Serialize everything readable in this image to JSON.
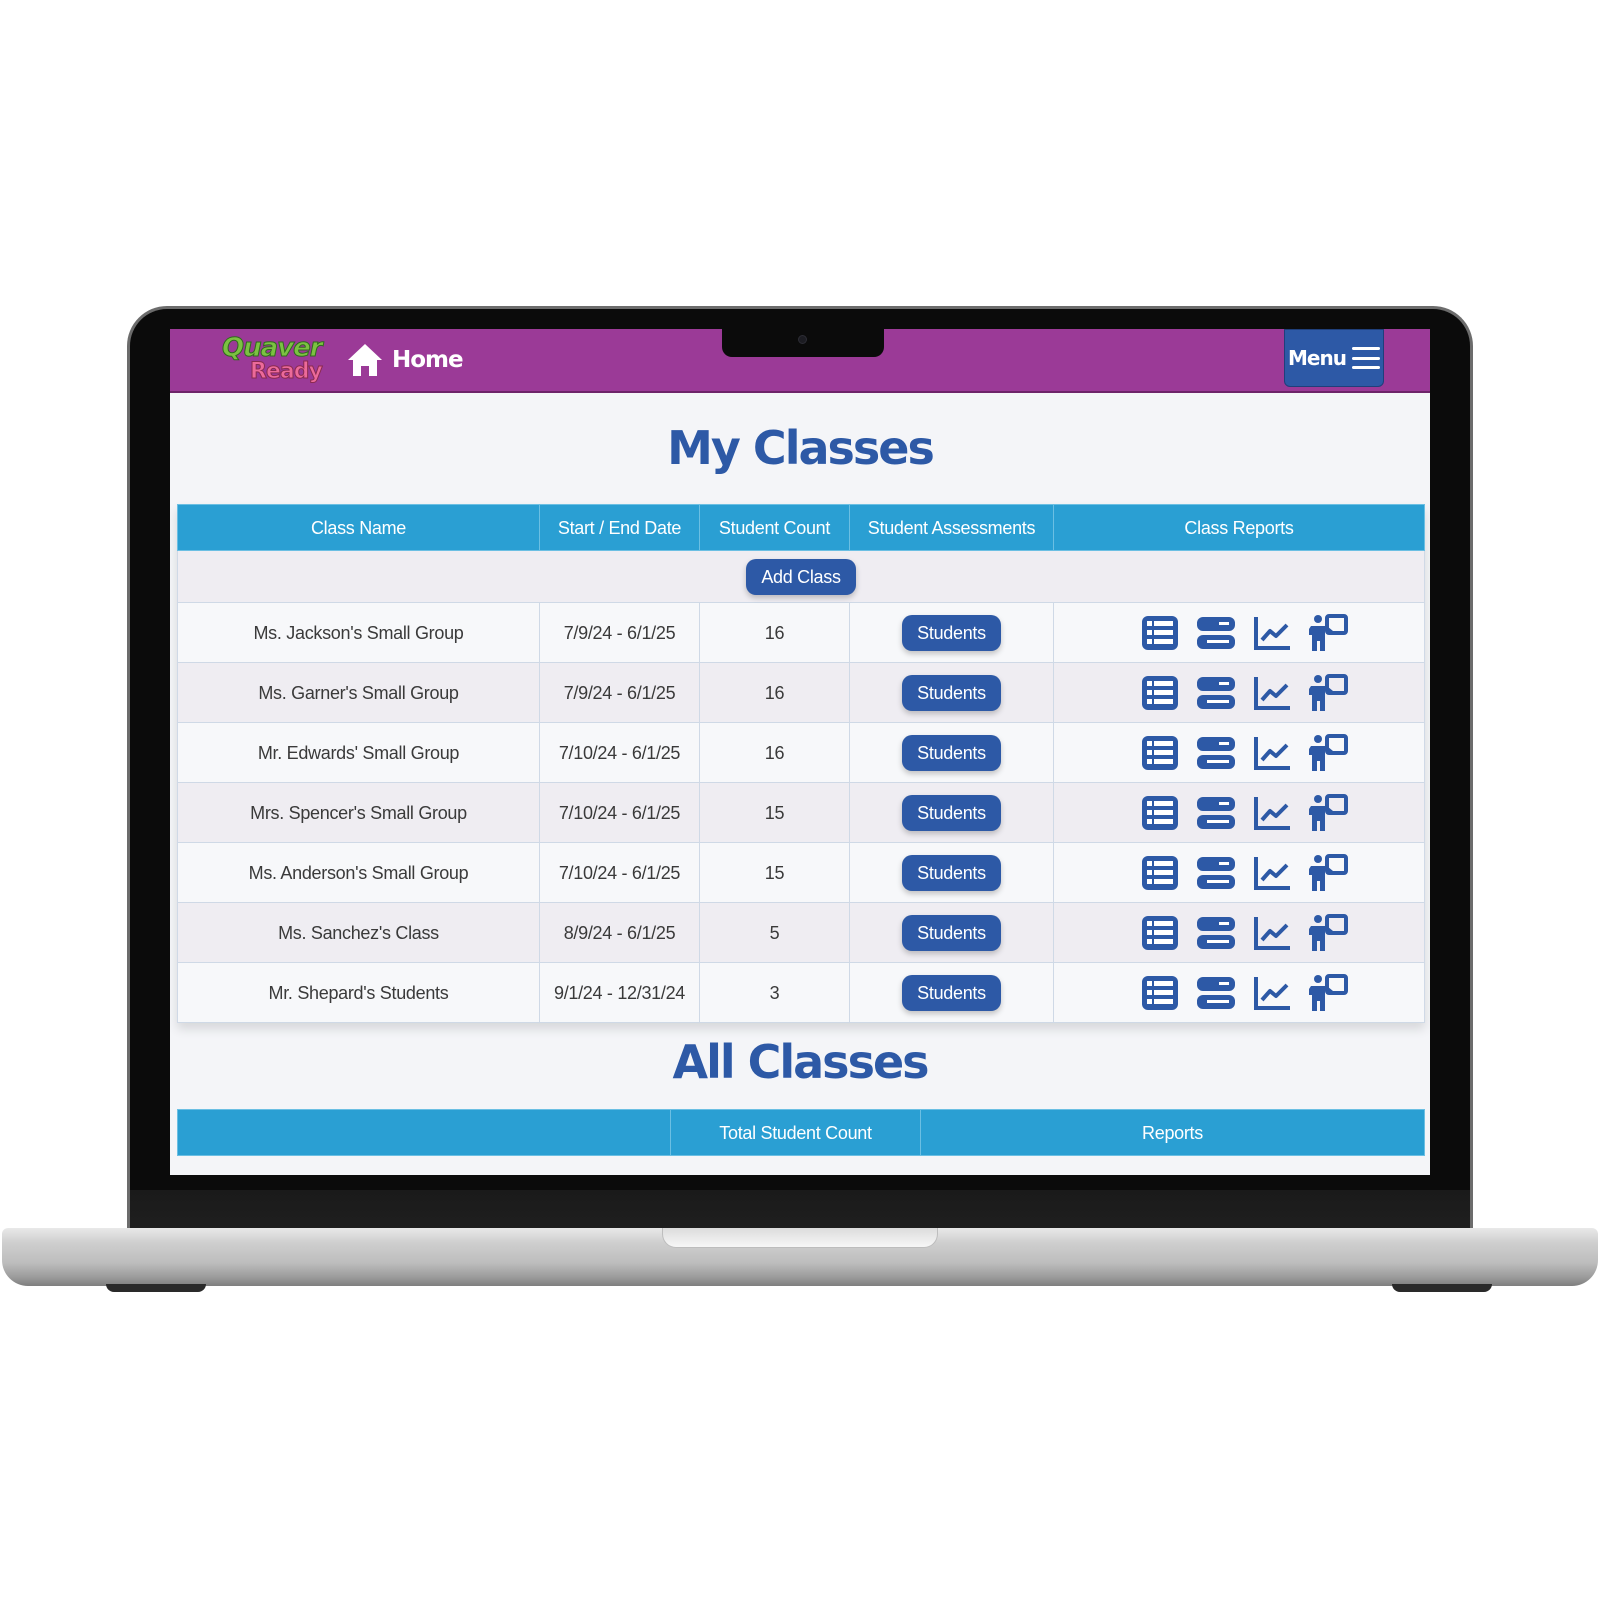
{
  "app": {
    "logo_top": "Quaver",
    "logo_bottom": "Ready",
    "home_label": "Home",
    "menu_label": "Menu"
  },
  "my_classes": {
    "title": "My Classes",
    "columns": [
      "Class Name",
      "Start / End Date",
      "Student Count",
      "Student Assessments",
      "Class Reports"
    ],
    "add_class_label": "Add Class",
    "students_button_label": "Students",
    "report_icons": [
      "table-list-icon",
      "server-rows-icon",
      "line-chart-icon",
      "teacher-board-icon"
    ],
    "rows": [
      {
        "name": "Ms. Jackson's Small Group",
        "dates": "7/9/24 - 6/1/25",
        "count": "16"
      },
      {
        "name": "Ms. Garner's Small Group",
        "dates": "7/9/24 - 6/1/25",
        "count": "16"
      },
      {
        "name": "Mr. Edwards' Small Group",
        "dates": "7/10/24 - 6/1/25",
        "count": "16"
      },
      {
        "name": "Mrs. Spencer's Small Group",
        "dates": "7/10/24 - 6/1/25",
        "count": "15"
      },
      {
        "name": "Ms. Anderson's Small Group",
        "dates": "7/10/24 - 6/1/25",
        "count": "15"
      },
      {
        "name": "Ms. Sanchez's Class",
        "dates": "8/9/24 - 6/1/25",
        "count": "5"
      },
      {
        "name": "Mr. Shepard's Students",
        "dates": "9/1/24 - 12/31/24",
        "count": "3"
      }
    ]
  },
  "all_classes": {
    "title": "All Classes",
    "columns": [
      "",
      "Total Student Count",
      "Reports"
    ]
  },
  "colors": {
    "nav_purple": "#9b3a97",
    "primary_blue": "#2d59a6",
    "header_cyan": "#2a9fd3"
  }
}
